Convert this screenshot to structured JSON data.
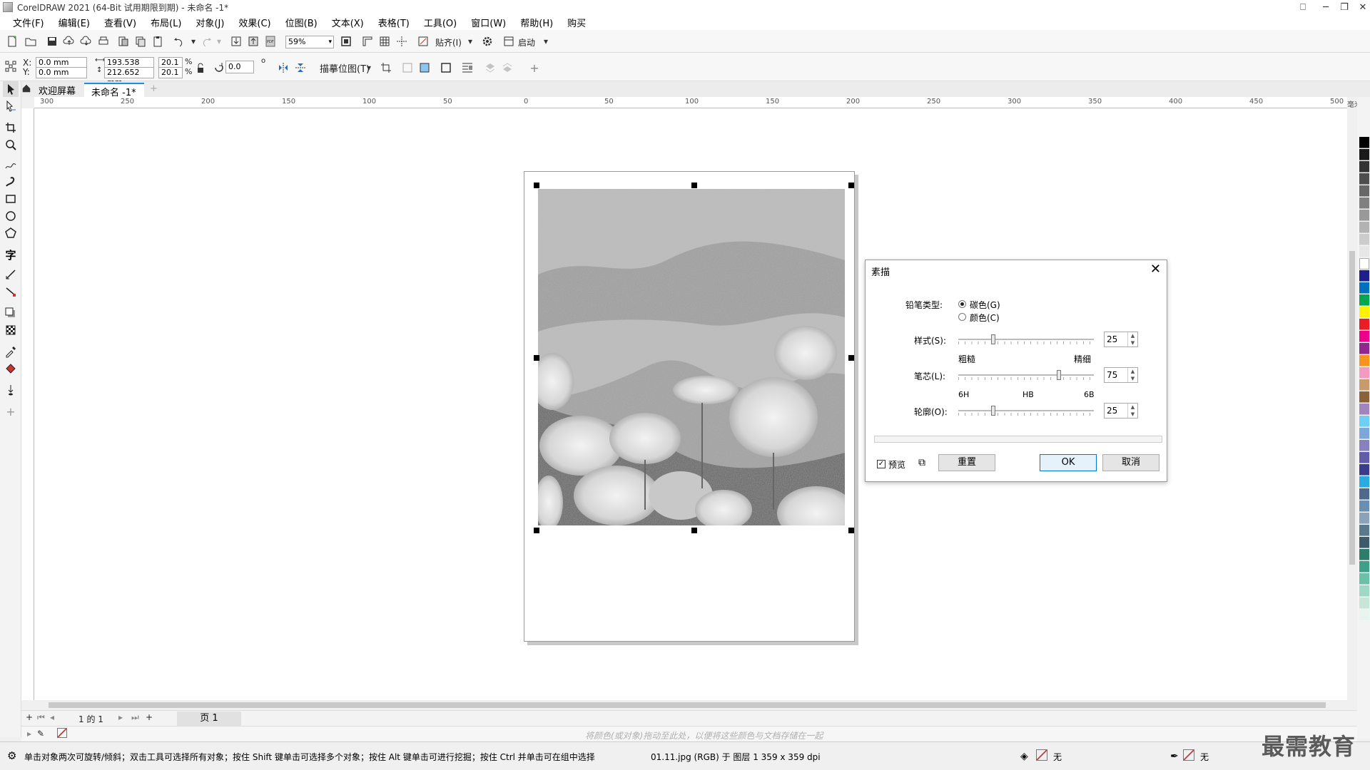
{
  "window": {
    "title": "CorelDRAW 2021 (64-Bit 试用期限到期) - 未命名 -1*"
  },
  "menubar": {
    "items": [
      "文件(F)",
      "编辑(E)",
      "查看(V)",
      "布局(L)",
      "对象(J)",
      "效果(C)",
      "位图(B)",
      "文本(X)",
      "表格(T)",
      "工具(O)",
      "窗口(W)",
      "帮助(H)",
      "购买"
    ]
  },
  "toolbar": {
    "zoom": "59%",
    "snap_label": "贴齐(I)",
    "launch_label": "启动"
  },
  "propertybar": {
    "x_label": "X:",
    "y_label": "Y:",
    "x_value": "0.0 mm",
    "y_value": "0.0 mm",
    "width_value": "193.538 mm",
    "height_value": "212.652 mm",
    "scale_x": "20.1",
    "scale_y": "20.1",
    "percent": "%",
    "rotation": "0.0",
    "degree": "o",
    "trace_bitmap_label": "描摹位图(T)"
  },
  "tabs": {
    "welcome": "欢迎屏幕",
    "document": "未命名 -1*"
  },
  "ruler": {
    "h_ticks": [
      "300",
      "250",
      "200",
      "150",
      "100",
      "50",
      "0",
      "50",
      "100",
      "150",
      "200",
      "250",
      "300",
      "350",
      "400",
      "450",
      "500"
    ],
    "unit": "毫米"
  },
  "dialog": {
    "title": "素描",
    "pencil_type_label": "铅笔类型:",
    "option_carbon": "碳色(G)",
    "option_color": "颜色(C)",
    "style_label": "样式(S):",
    "style_value": "25",
    "style_min": "粗糙",
    "style_max": "精细",
    "lead_label": "笔芯(L):",
    "lead_value": "75",
    "lead_min": "6H",
    "lead_mid": "HB",
    "lead_max": "6B",
    "outline_label": "轮廓(O):",
    "outline_value": "25",
    "preview_label": "预览",
    "reset_label": "重置",
    "ok_label": "OK",
    "cancel_label": "取消",
    "style_fraction": 0.25,
    "lead_fraction": 0.75,
    "outline_fraction": 0.25
  },
  "pagenav": {
    "page_info": "1 的 1",
    "page_tab": "页 1"
  },
  "colorbar": {
    "hint": "将颜色(或对象)拖动至此处，以便将这些颜色与文档存储在一起"
  },
  "status": {
    "hint": "单击对象两次可旋转/倾斜；双击工具可选择所有对象；按住 Shift 键单击可选择多个对象；按住 Alt 键单击可进行挖掘；按住 Ctrl 并单击可在组中选择",
    "object_info": "01.11.jpg (RGB) 于 图层 1 359 x 359 dpi",
    "fill_label": "无",
    "outline_label": "无"
  },
  "watermark": "最需教育",
  "palette_colors": [
    "#000000",
    "#1a1a1a",
    "#333333",
    "#4d4d4d",
    "#666666",
    "#808080",
    "#999999",
    "#b3b3b3",
    "#cccccc",
    "#e6e6e6",
    "#ffffff",
    "#1e1e8c",
    "#0072bc",
    "#00a651",
    "#fff200",
    "#ed1c24",
    "#ec008c",
    "#92278f",
    "#f7941d",
    "#f49ac1",
    "#c69c6d",
    "#8c6239",
    "#a186be",
    "#6dcff6",
    "#7da7d9",
    "#8781bd",
    "#605ca8",
    "#3c3c8c",
    "#29abe2",
    "#4d6a8c",
    "#6b8fb0",
    "#8aa3b8",
    "#5a7a8c",
    "#3d5c6b",
    "#2e7d6b",
    "#3fa08a",
    "#6cc0a8",
    "#9fd8c4",
    "#c8e6d8",
    "#e8f4ee"
  ]
}
